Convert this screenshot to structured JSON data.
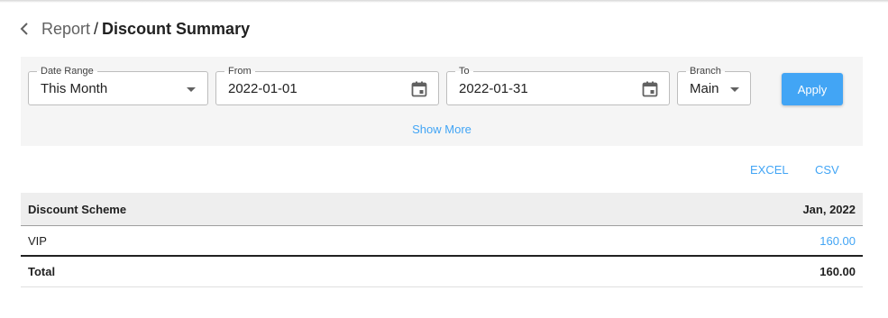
{
  "header": {
    "parent": "Report",
    "separator": "/",
    "title": "Discount Summary"
  },
  "filters": {
    "date_range": {
      "label": "Date Range",
      "value": "This Month"
    },
    "from": {
      "label": "From",
      "value": "2022-01-01"
    },
    "to": {
      "label": "To",
      "value": "2022-01-31"
    },
    "branch": {
      "label": "Branch",
      "value": "Main"
    },
    "apply_label": "Apply",
    "show_more_label": "Show More"
  },
  "export": {
    "excel_label": "EXCEL",
    "csv_label": "CSV"
  },
  "table": {
    "columns": [
      "Discount Scheme",
      "Jan, 2022"
    ],
    "rows": [
      {
        "scheme": "VIP",
        "value": "160.00"
      }
    ],
    "total": {
      "label": "Total",
      "value": "160.00"
    }
  },
  "colors": {
    "accent": "#42a5f5",
    "panel": "#f5f5f5",
    "table_header": "#eeeeee"
  }
}
